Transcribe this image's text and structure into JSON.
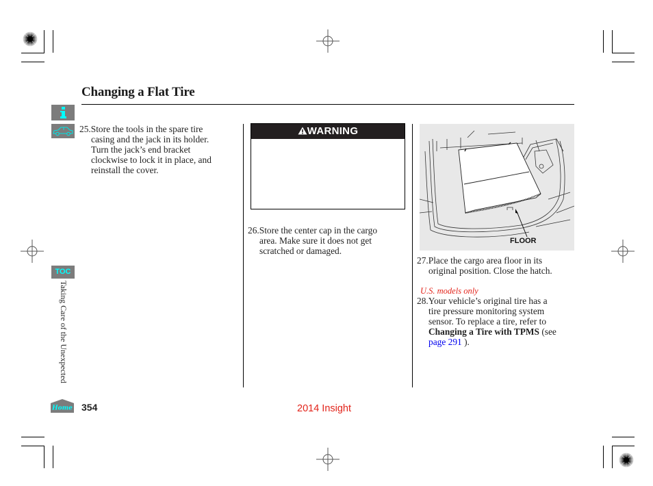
{
  "page": {
    "title": "Changing a Flat Tire",
    "section_label": "Taking Care of the Unexpected",
    "page_number": "354",
    "footer_title": "2014 Insight"
  },
  "nav": {
    "info_icon": "info-icon",
    "car_icon": "car-icon",
    "toc_label": "TOC",
    "home_label": "Home"
  },
  "steps": [
    {
      "number": "25.",
      "first_line": "Store the tools in the spare tire",
      "rest": [
        "casing and the jack in its holder.",
        "Turn the jack’s end bracket",
        "clockwise to lock it in place, and",
        "reinstall the cover."
      ]
    },
    {
      "number": "26.",
      "first_line": "Store the center cap in the cargo",
      "rest": [
        "area. Make sure it does not get",
        "scratched or damaged."
      ]
    },
    {
      "number": "27.",
      "first_line": "Place the cargo area floor in its",
      "rest": [
        "original position. Close the hatch."
      ]
    },
    {
      "number": "28.",
      "first_line": "Your vehicle’s original tire has a",
      "rest": [
        "tire pressure monitoring system",
        "sensor. To replace a tire, refer to"
      ],
      "ref_bold": "Changing a Tire with TPMS",
      "ref_see": " (see",
      "ref_link": "page 291",
      "ref_end": " )."
    }
  ],
  "warning": {
    "icon": "warning-triangle-icon",
    "label": "WARNING"
  },
  "figure": {
    "label": "FLOOR"
  },
  "notes": {
    "us_only": "U.S. models only"
  },
  "colors": {
    "accent_cyan": "#00ffff",
    "nav_gray": "#7c7c7c",
    "footer_red": "#e2231a",
    "link_blue": "#0000ee"
  }
}
